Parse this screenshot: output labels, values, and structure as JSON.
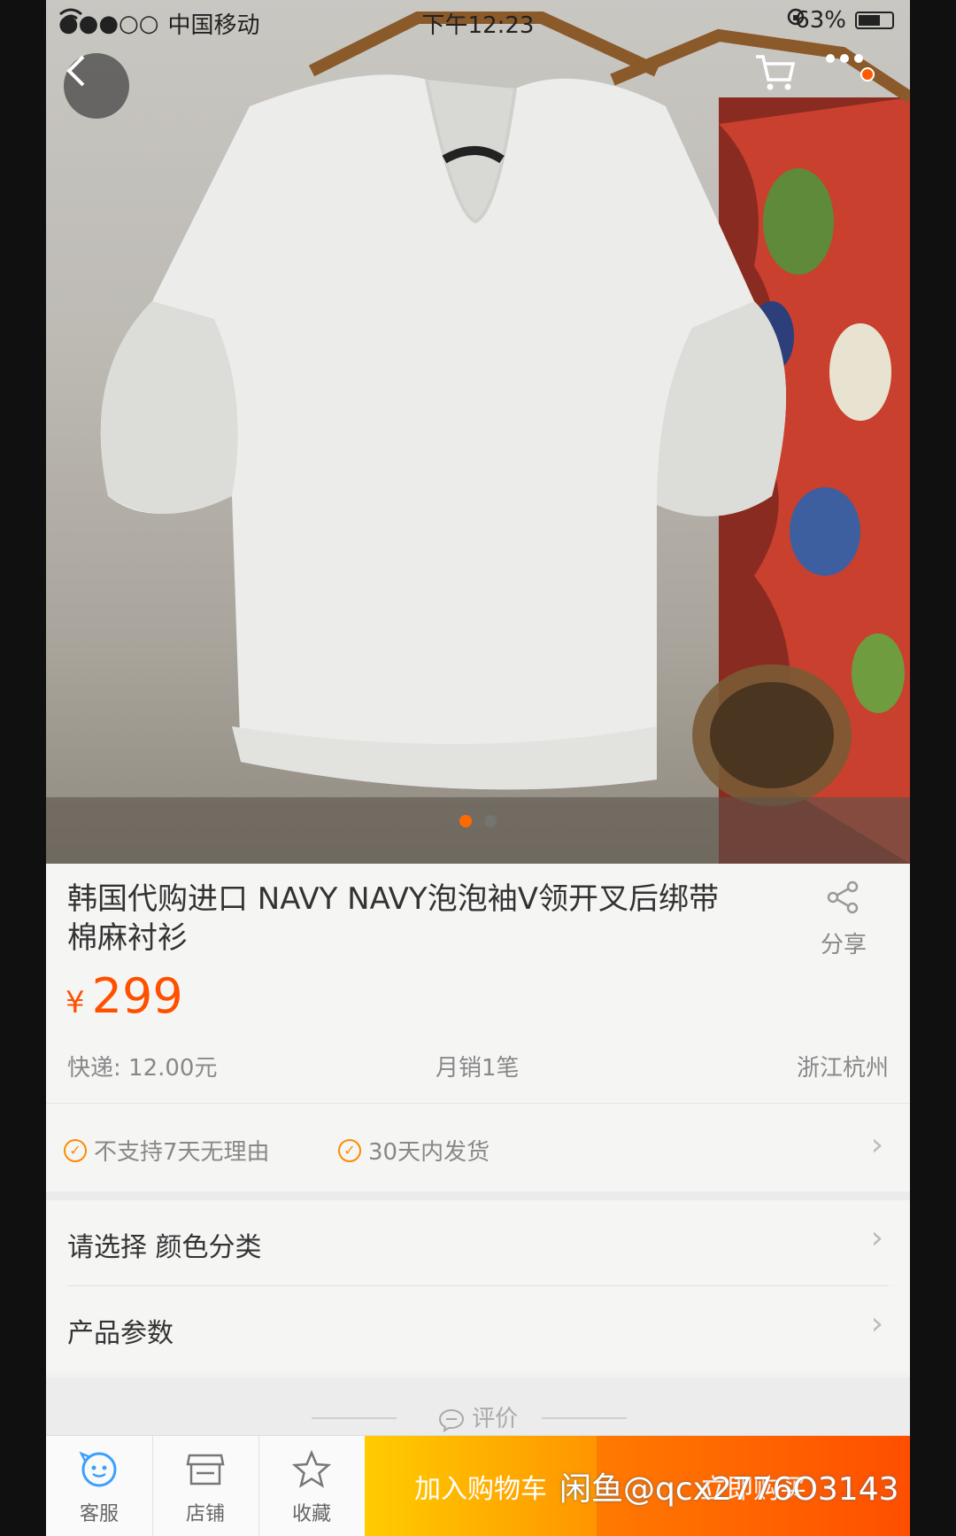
{
  "status_bar": {
    "signal": "●●●○○",
    "carrier": "中国移动",
    "time": "下午12:23",
    "battery": "63%"
  },
  "product": {
    "title": "韩国代购进口 NAVY NAVY泡泡袖V领开叉后绑带棉麻衬衫",
    "currency": "¥",
    "price": "299",
    "shipping": "快递: 12.00元",
    "monthly_sales": "月销1笔",
    "location": "浙江杭州",
    "share_label": "分享"
  },
  "guarantees": [
    {
      "label": "不支持7天无理由"
    },
    {
      "label": "30天内发货"
    }
  ],
  "options": {
    "select_label": "请选择 颜色分类",
    "params_label": "产品参数"
  },
  "reviews": {
    "label": "评价"
  },
  "bottom_bar": {
    "service": "客服",
    "shop": "店铺",
    "favorite": "收藏",
    "add_to_cart": "加入购物车",
    "buy_now": "立即购买"
  },
  "watermark": "闲鱼@qcx2776O3143",
  "colors": {
    "accent": "#ff5000",
    "cart_button": "#ff9500",
    "buy_button": "#ff4e00"
  },
  "carousel": {
    "total": 2,
    "active": 1
  }
}
